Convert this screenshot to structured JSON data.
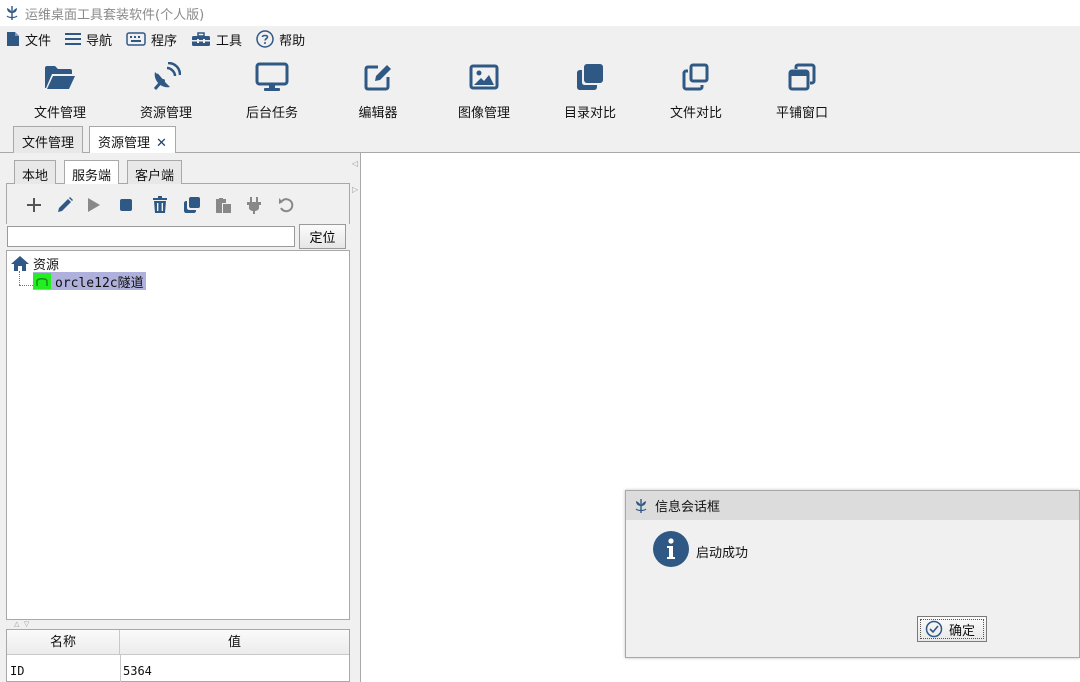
{
  "window": {
    "title": "运维桌面工具套装软件(个人版)"
  },
  "menu": [
    {
      "label": "文件",
      "icon": "file-icon"
    },
    {
      "label": "导航",
      "icon": "list-icon"
    },
    {
      "label": "程序",
      "icon": "keyboard-icon"
    },
    {
      "label": "工具",
      "icon": "toolbox-icon"
    },
    {
      "label": "帮助",
      "icon": "help-icon"
    }
  ],
  "toolbar": [
    {
      "label": "文件管理",
      "icon": "folder-open-icon"
    },
    {
      "label": "资源管理",
      "icon": "satellite-dish-icon"
    },
    {
      "label": "后台任务",
      "icon": "monitor-icon"
    },
    {
      "label": "编辑器",
      "icon": "edit-icon"
    },
    {
      "label": "图像管理",
      "icon": "image-icon"
    },
    {
      "label": "目录对比",
      "icon": "copy-filled-icon"
    },
    {
      "label": "文件对比",
      "icon": "copy-outline-icon"
    },
    {
      "label": "平铺窗口",
      "icon": "window-restore-icon"
    }
  ],
  "tabs": [
    {
      "label": "文件管理",
      "active": false,
      "closable": false
    },
    {
      "label": "资源管理",
      "active": true,
      "closable": true,
      "close_glyph": "✕"
    }
  ],
  "resource_panel": {
    "tabs": [
      {
        "label": "本地",
        "active": false
      },
      {
        "label": "服务端",
        "active": true
      },
      {
        "label": "客户端",
        "active": false
      }
    ],
    "actions": [
      "add-icon",
      "edit-icon",
      "play-icon",
      "stop-icon",
      "trash-icon",
      "copy-icon",
      "paste-icon",
      "plug-icon",
      "undo-icon"
    ],
    "search": {
      "value": "",
      "placeholder": ""
    },
    "locate_label": "定位",
    "tree": {
      "root": {
        "label": "资源",
        "icon": "home-icon"
      },
      "children": [
        {
          "label": "orcle12c隧道",
          "icon": "tunnel-icon",
          "selected": true,
          "status_color": "#22ee22"
        }
      ]
    },
    "properties": {
      "columns": [
        "名称",
        "值"
      ],
      "rows": [
        {
          "name": "ID",
          "value": "5364"
        }
      ]
    }
  },
  "dialog": {
    "title": "信息会话框",
    "message": "启动成功",
    "ok_label": "确定",
    "icon": "info-icon"
  },
  "colors": {
    "accent": "#2f5885",
    "selection": "#b0b0dc",
    "status_ok": "#22ee22"
  }
}
